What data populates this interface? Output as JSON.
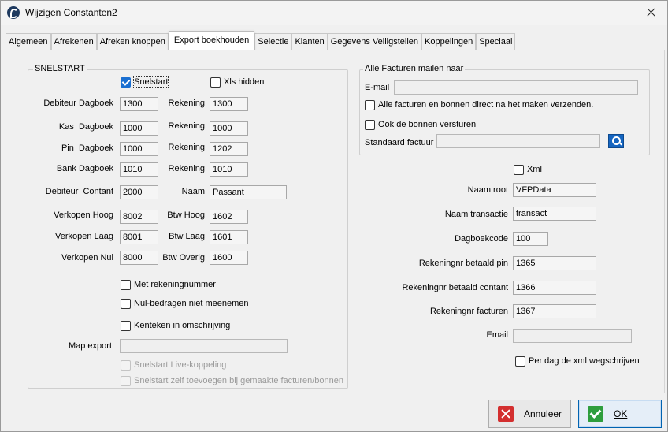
{
  "window": {
    "title": "Wijzigen Constanten2"
  },
  "tabs": [
    "Algemeen",
    "Afrekenen",
    "Afreken knoppen",
    "Export boekhouden",
    "Selectie",
    "Klanten",
    "Gegevens Veiligstellen",
    "Koppelingen",
    "Speciaal"
  ],
  "active_tab": "Export boekhouden",
  "snelstart": {
    "legend": "SNELSTART",
    "snelstart_cb": {
      "label": "Snelstart",
      "checked": true
    },
    "xls_hidden_cb": {
      "label": "Xls hidden",
      "checked": false
    },
    "rows": [
      {
        "label": "Debiteur Dagboek",
        "value": "1300",
        "label2": "Rekening",
        "value2": "1300"
      },
      {
        "label": "Kas  Dagboek",
        "value": "1000",
        "label2": "Rekening",
        "value2": "1000"
      },
      {
        "label": "Pin  Dagboek",
        "value": "1000",
        "label2": "Rekening",
        "value2": "1202"
      },
      {
        "label": "Bank Dagboek",
        "value": "1010",
        "label2": "Rekening",
        "value2": "1010"
      },
      {
        "label": "Debiteur  Contant",
        "value": "2000",
        "label2": "Naam",
        "value2": "Passant"
      },
      {
        "label": "Verkopen Hoog",
        "value": "8002",
        "label2": "Btw Hoog",
        "value2": "1602"
      },
      {
        "label": "Verkopen Laag",
        "value": "8001",
        "label2": "Btw Laag",
        "value2": "1601"
      },
      {
        "label": "Verkopen Nul",
        "value": "8000",
        "label2": "Btw Overig",
        "value2": "1600"
      }
    ],
    "met_rekeningnummer": {
      "label": "Met rekeningnummer",
      "checked": false
    },
    "nul_bedragen": {
      "label": "Nul-bedragen niet meenemen",
      "checked": false
    },
    "kenteken": {
      "label": "Kenteken in omschrijving",
      "checked": false
    },
    "map_export_label": "Map export",
    "map_export_value": "",
    "live_koppeling": {
      "label": "Snelstart Live-koppeling",
      "checked": false
    },
    "zelf_toevoegen": {
      "label": "Snelstart zelf toevoegen bij gemaakte facturen/bonnen",
      "checked": false
    }
  },
  "mail": {
    "legend": "Alle Facturen mailen naar",
    "email_label": "E-mail",
    "email_value": "",
    "direct_verzenden": {
      "label": "Alle facturen en bonnen direct na het maken verzenden.",
      "checked": false
    },
    "bonnen_versturen": {
      "label": "Ook de bonnen versturen",
      "checked": false
    },
    "standaard_factuur_label": "Standaard factuur",
    "standaard_factuur_value": ""
  },
  "xml": {
    "xml_cb": {
      "label": "Xml",
      "checked": false
    },
    "naam_root_label": "Naam root",
    "naam_root_value": "VFPData",
    "naam_transactie_label": "Naam transactie",
    "naam_transactie_value": "transact",
    "dagboekcode_label": "Dagboekcode",
    "dagboekcode_value": "100",
    "betaald_pin_label": "Rekeningnr betaald pin",
    "betaald_pin_value": "1365",
    "betaald_contant_label": "Rekeningnr betaald contant",
    "betaald_contant_value": "1366",
    "facturen_label": "Rekeningnr facturen",
    "facturen_value": "1367",
    "email_label": "Email",
    "email_value": "",
    "per_dag": {
      "label": "Per dag de xml wegschrijven",
      "checked": false
    }
  },
  "buttons": {
    "cancel_label": "Annuleer",
    "ok_label": "OK"
  },
  "colors": {
    "accent": "#0063b1",
    "cancel": "#d32f2f",
    "ok": "#2e9e3e",
    "search": "#1565c0"
  }
}
